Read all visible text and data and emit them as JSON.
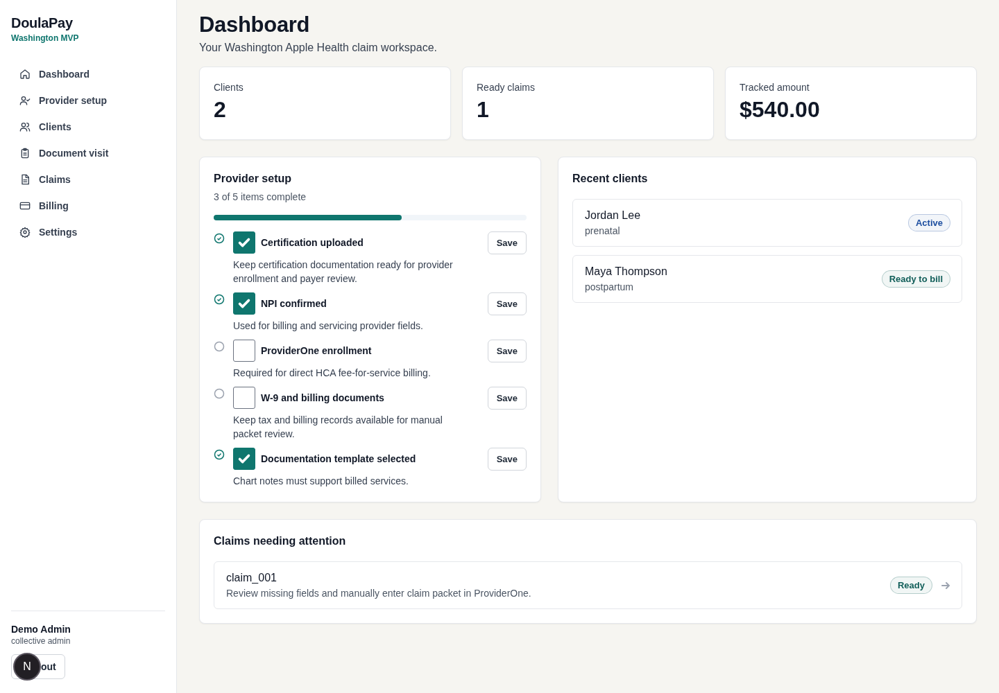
{
  "sidebar": {
    "brand": "DoulaPay",
    "subtitle": "Washington MVP",
    "items": [
      {
        "label": "Dashboard"
      },
      {
        "label": "Provider setup"
      },
      {
        "label": "Clients"
      },
      {
        "label": "Document visit"
      },
      {
        "label": "Claims"
      },
      {
        "label": "Billing"
      },
      {
        "label": "Settings"
      }
    ],
    "user": {
      "name": "Demo Admin",
      "role": "collective admin"
    },
    "sign_out_button": "out",
    "dev_badge": "N"
  },
  "header": {
    "title": "Dashboard",
    "subtitle": "Your Washington Apple Health claim workspace."
  },
  "stats": [
    {
      "label": "Clients",
      "value": "2"
    },
    {
      "label": "Ready claims",
      "value": "1"
    },
    {
      "label": "Tracked amount",
      "value": "$540.00"
    }
  ],
  "provider_setup": {
    "title": "Provider setup",
    "summary": "3 of 5 items complete",
    "level": 0.6,
    "items": [
      {
        "label": "Certification uploaded",
        "description": "Keep certification documentation ready for provider enrollment and payer review.",
        "checked": true,
        "button": "Save"
      },
      {
        "label": "NPI confirmed",
        "description": "Used for billing and servicing provider fields.",
        "checked": true,
        "button": "Save"
      },
      {
        "label": "ProviderOne enrollment",
        "description": "Required for direct HCA fee-for-service billing.",
        "checked": false,
        "button": "Save"
      },
      {
        "label": "W-9 and billing documents",
        "description": "Keep tax and billing records available for manual packet review.",
        "checked": false,
        "button": "Save"
      },
      {
        "label": "Documentation template selected",
        "description": "Chart notes must support billed services.",
        "checked": true,
        "button": "Save"
      }
    ]
  },
  "recent_clients": {
    "title": "Recent clients",
    "items": [
      {
        "name": "Jordan Lee",
        "type": "prenatal",
        "status": "Active",
        "color": "#1e4fa0"
      },
      {
        "name": "Maya Thompson",
        "type": "postpartum",
        "status": "Ready to bill",
        "color": "#115e59"
      }
    ]
  },
  "claims": {
    "title": "Claims needing attention",
    "items": [
      {
        "id": "claim_001",
        "description": "Review missing fields and manually enter claim packet in ProviderOne.",
        "status": "Ready",
        "color": "#115e59"
      }
    ]
  }
}
